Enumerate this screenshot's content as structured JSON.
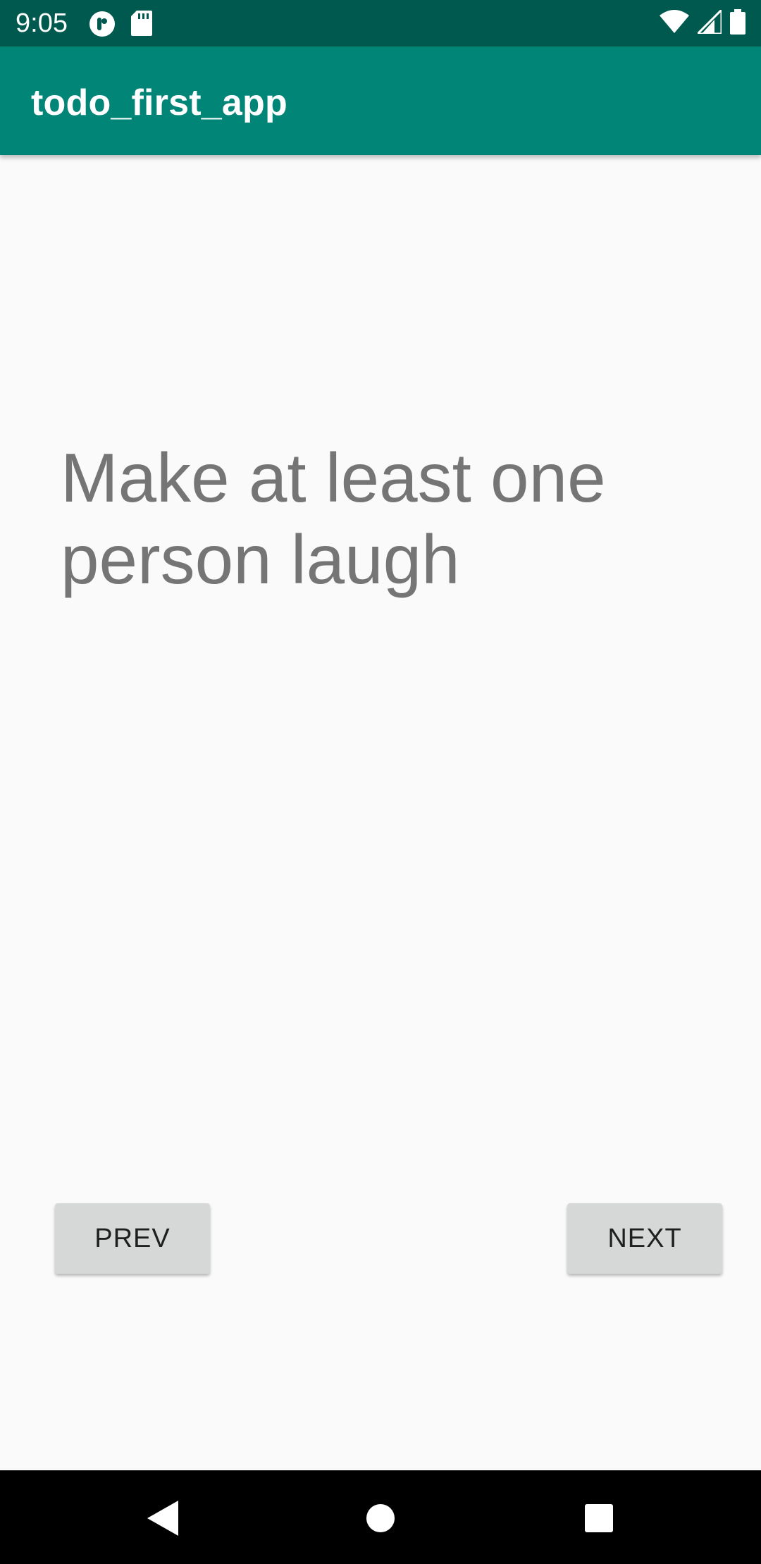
{
  "status_bar": {
    "time": "9:05",
    "icons": [
      "notification-app-icon",
      "sd-card-icon",
      "wifi-icon",
      "cell-signal-icon",
      "battery-icon"
    ]
  },
  "app_bar": {
    "title": "todo_first_app",
    "color": "#008577"
  },
  "main": {
    "todo_text": "Make at least one person laugh"
  },
  "buttons": {
    "prev_label": "PREV",
    "next_label": "NEXT"
  },
  "nav_bar": {
    "icons": [
      "back-icon",
      "home-icon",
      "recents-icon"
    ]
  },
  "colors": {
    "status_bar": "#00594e",
    "app_bar": "#008577",
    "background": "#fafafa",
    "text": "#757575",
    "button": "#d6d7d7"
  }
}
